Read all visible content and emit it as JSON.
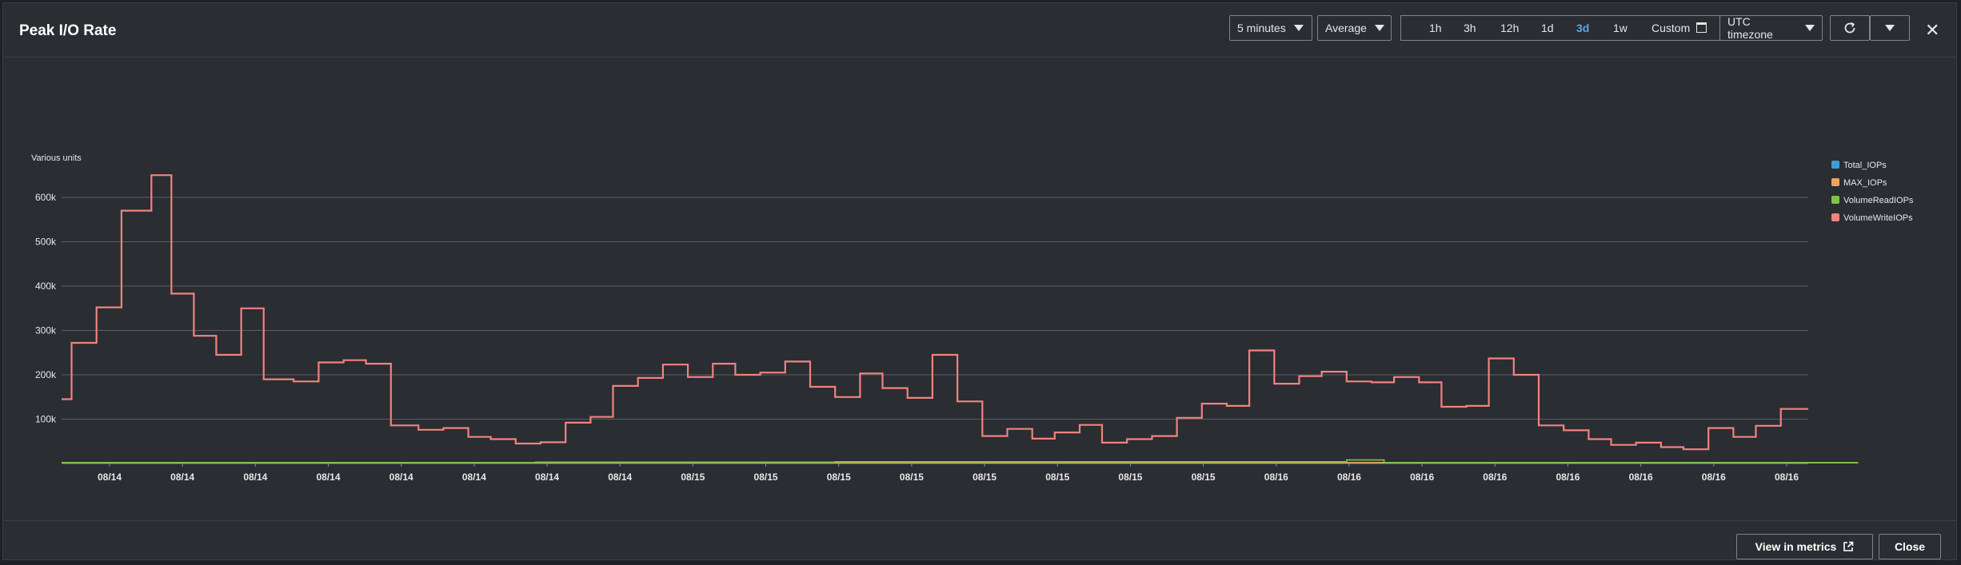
{
  "header": {
    "title": "Peak I/O Rate",
    "period": "5 minutes",
    "statistic": "Average",
    "ranges": [
      "1h",
      "3h",
      "12h",
      "1d",
      "3d",
      "1w"
    ],
    "active_range": "3d",
    "custom_label": "Custom",
    "timezone": "UTC timezone"
  },
  "footer": {
    "view_in_metrics": "View in metrics",
    "close": "Close"
  },
  "colors": {
    "Total_IOPs": "#3d9fd6",
    "MAX_IOPs": "#f0a45a",
    "VolumeReadIOPs": "#7fc449",
    "VolumeWriteIOPs": "#f2827f",
    "grid": "#5a5f66",
    "axis_text": "#e6e7e8"
  },
  "chart_data": {
    "type": "line",
    "ylabel": "Various units",
    "ylim": [
      0,
      700000
    ],
    "y_ticks": [
      100000,
      200000,
      300000,
      400000,
      500000,
      600000
    ],
    "y_tick_labels": [
      "100k",
      "200k",
      "300k",
      "400k",
      "500k",
      "600k"
    ],
    "x_tick_labels": [
      "08/14",
      "08/14",
      "08/14",
      "08/14",
      "08/14",
      "08/14",
      "08/14",
      "08/14",
      "08/15",
      "08/15",
      "08/15",
      "08/15",
      "08/15",
      "08/15",
      "08/15",
      "08/15",
      "08/16",
      "08/16",
      "08/16",
      "08/16",
      "08/16",
      "08/16",
      "08/16",
      "08/16"
    ],
    "grid": true,
    "legend": "right",
    "series": [
      {
        "name": "Total_IOPs",
        "step": [
          [
            0,
            2000
          ],
          [
            72,
            2000
          ]
        ]
      },
      {
        "name": "MAX_IOPs",
        "step": [
          [
            0,
            2000
          ],
          [
            72,
            2000
          ]
        ]
      },
      {
        "name": "VolumeReadIOPs",
        "step": [
          [
            0,
            2000
          ],
          [
            19,
            3000
          ],
          [
            31,
            4000
          ],
          [
            51.5,
            8000
          ],
          [
            53,
            2000
          ],
          [
            72,
            2000
          ]
        ]
      },
      {
        "name": "VolumeWriteIOPs",
        "step": [
          [
            0,
            145000
          ],
          [
            0.4,
            272000
          ],
          [
            1.4,
            352000
          ],
          [
            2.4,
            570000
          ],
          [
            3.6,
            650000
          ],
          [
            4.4,
            383000
          ],
          [
            5.3,
            288000
          ],
          [
            6.2,
            245000
          ],
          [
            7.2,
            350000
          ],
          [
            8.1,
            190000
          ],
          [
            9.3,
            185000
          ],
          [
            10.3,
            228000
          ],
          [
            11.3,
            233000
          ],
          [
            12.2,
            225000
          ],
          [
            13.2,
            86000
          ],
          [
            14.3,
            76000
          ],
          [
            15.3,
            80000
          ],
          [
            16.3,
            60000
          ],
          [
            17.2,
            55000
          ],
          [
            18.2,
            45000
          ],
          [
            19.2,
            48000
          ],
          [
            20.2,
            92000
          ],
          [
            21.2,
            105000
          ],
          [
            22.1,
            175000
          ],
          [
            23.1,
            193000
          ],
          [
            24.1,
            223000
          ],
          [
            25.1,
            195000
          ],
          [
            26.1,
            225000
          ],
          [
            27.0,
            200000
          ],
          [
            28.0,
            205000
          ],
          [
            29.0,
            230000
          ],
          [
            30.0,
            173000
          ],
          [
            31.0,
            150000
          ],
          [
            32.0,
            203000
          ],
          [
            32.9,
            170000
          ],
          [
            33.9,
            148000
          ],
          [
            34.9,
            245000
          ],
          [
            35.9,
            140000
          ],
          [
            36.9,
            62000
          ],
          [
            37.9,
            78000
          ],
          [
            38.9,
            56000
          ],
          [
            39.8,
            70000
          ],
          [
            40.8,
            87000
          ],
          [
            41.7,
            47000
          ],
          [
            42.7,
            55000
          ],
          [
            43.7,
            62000
          ],
          [
            44.7,
            103000
          ],
          [
            45.7,
            135000
          ],
          [
            46.7,
            130000
          ],
          [
            47.6,
            255000
          ],
          [
            48.6,
            180000
          ],
          [
            49.6,
            197000
          ],
          [
            50.5,
            207000
          ],
          [
            51.5,
            185000
          ],
          [
            52.5,
            183000
          ],
          [
            53.4,
            195000
          ],
          [
            54.4,
            183000
          ],
          [
            55.3,
            128000
          ],
          [
            56.3,
            130000
          ],
          [
            57.2,
            237000
          ],
          [
            58.2,
            200000
          ],
          [
            59.2,
            86000
          ],
          [
            60.2,
            75000
          ],
          [
            61.2,
            55000
          ],
          [
            62.1,
            42000
          ],
          [
            63.1,
            47000
          ],
          [
            64.1,
            37000
          ],
          [
            65.0,
            32000
          ],
          [
            66.0,
            80000
          ],
          [
            67.0,
            60000
          ],
          [
            67.9,
            85000
          ],
          [
            68.9,
            123000
          ],
          [
            70.0,
            123000
          ]
        ]
      }
    ]
  }
}
